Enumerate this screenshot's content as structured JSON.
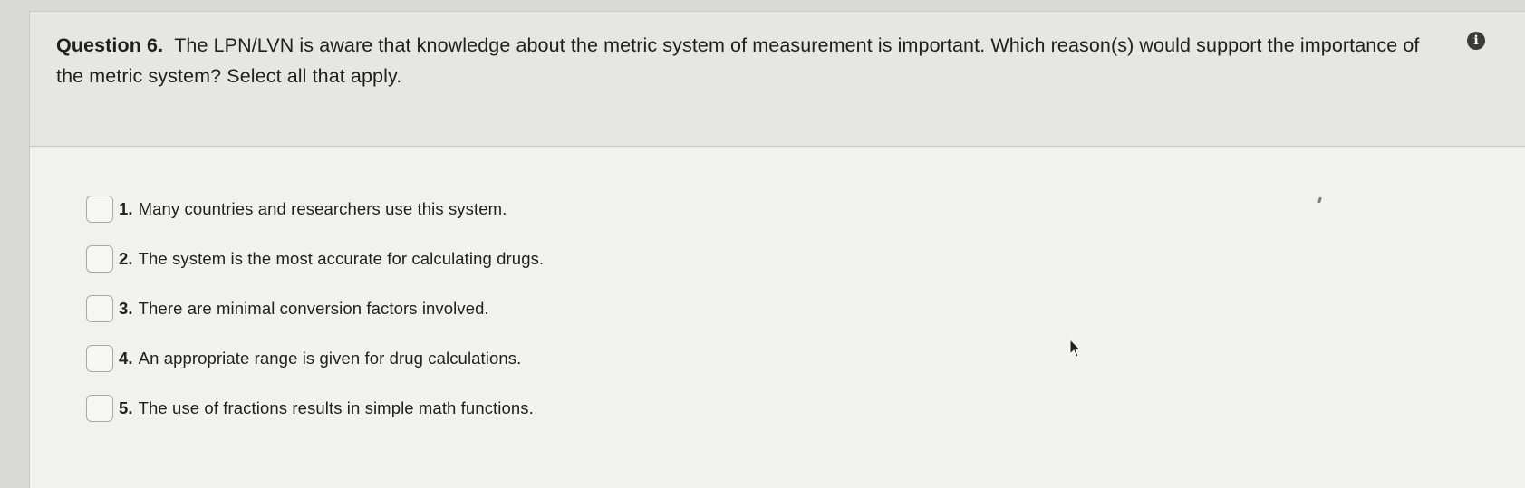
{
  "question": {
    "number_label": "Question 6.",
    "text": "The LPN/LVN is aware that knowledge about the metric system of measurement is important. Which reason(s) would support the importance of the metric system? Select all that apply.",
    "info_icon": "info-icon"
  },
  "options": [
    {
      "number": "1.",
      "text": "Many countries and researchers use this system.",
      "checked": false
    },
    {
      "number": "2.",
      "text": "The system is the most accurate for calculating drugs.",
      "checked": false
    },
    {
      "number": "3.",
      "text": "There are minimal conversion factors involved.",
      "checked": false
    },
    {
      "number": "4.",
      "text": "An appropriate range is given for drug calculations.",
      "checked": false
    },
    {
      "number": "5.",
      "text": "The use of fractions results in simple math functions.",
      "checked": false
    }
  ],
  "colors": {
    "header_background": "#e6e6e4",
    "card_background": "#f1f1ef",
    "text": "#1f1f1f",
    "checkbox_border": "#a8a8a6"
  }
}
